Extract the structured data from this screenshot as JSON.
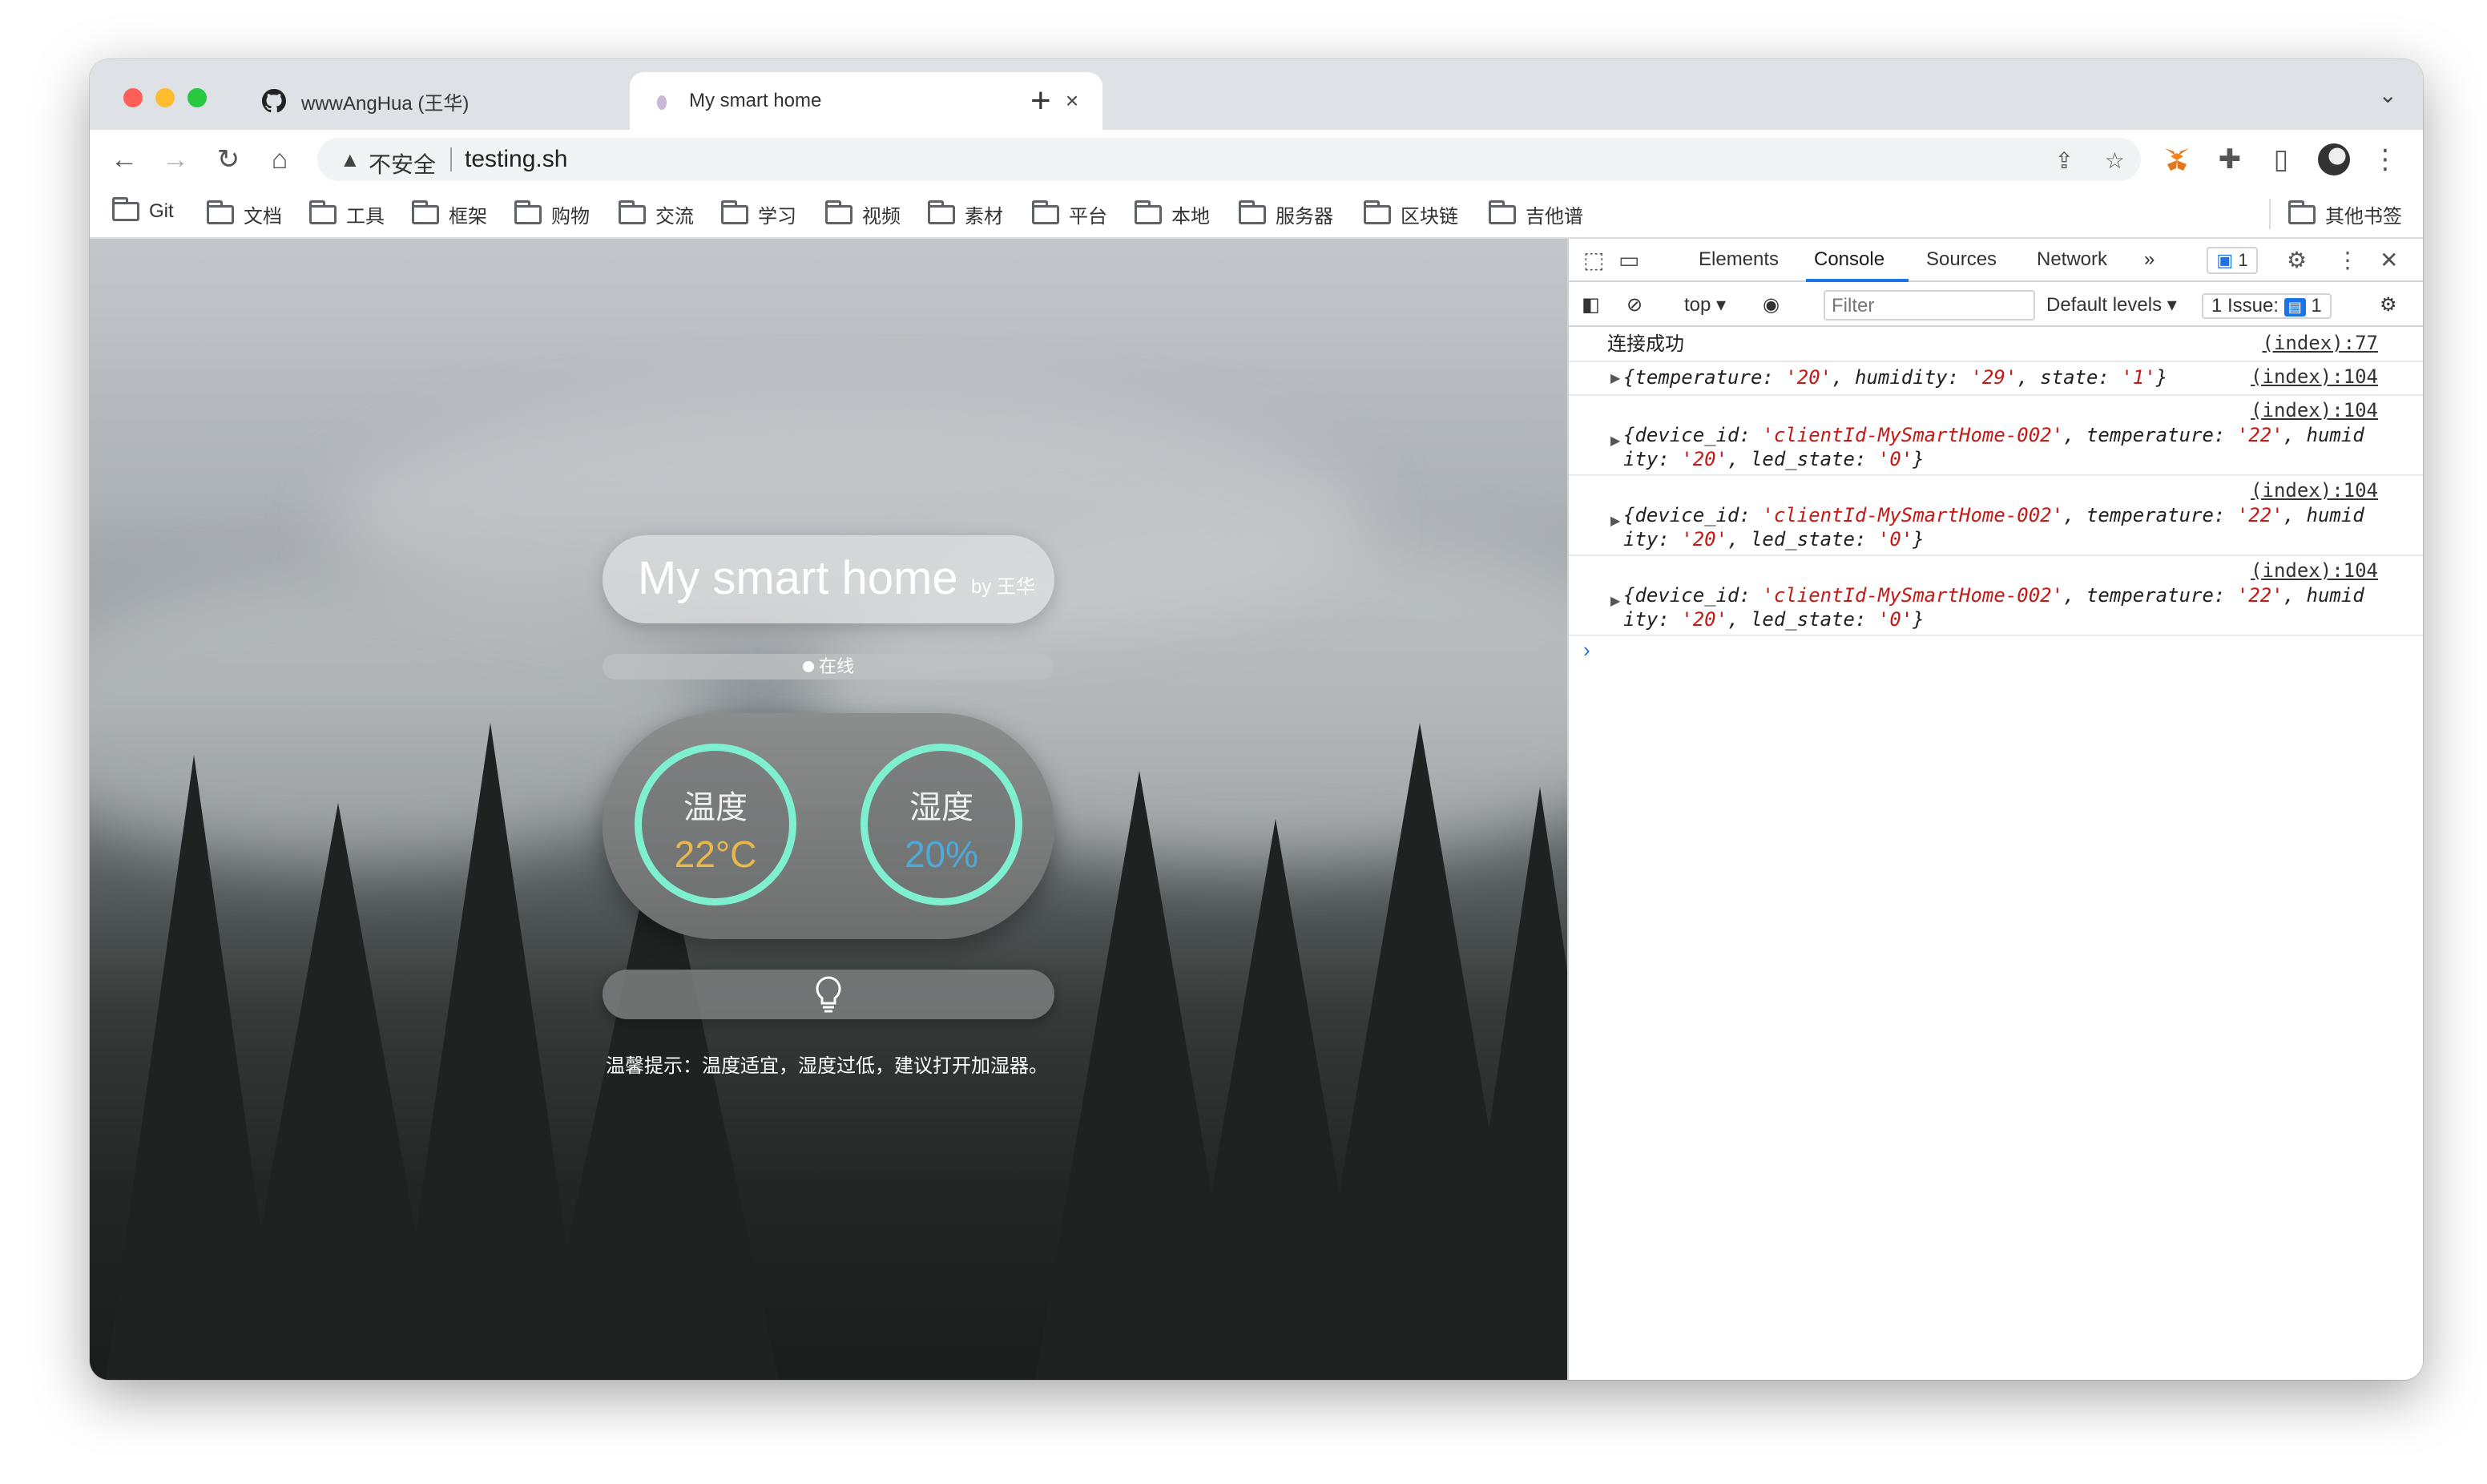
{
  "tabs": [
    {
      "title": "wwwAngHua (王华)",
      "icon": "github-icon",
      "close": "×"
    },
    {
      "title": "My smart home",
      "icon": "favicon-icon",
      "close": "×"
    }
  ],
  "new_tab_label": "+",
  "address_bar": {
    "warning_icon": "warning-icon",
    "security_text": "不安全",
    "url": "testing.sh"
  },
  "bookmarks": [
    "Git",
    "文档",
    "工具",
    "框架",
    "购物",
    "交流",
    "学习",
    "视频",
    "素材",
    "平台",
    "本地",
    "服务器",
    "区块链",
    "吉他谱"
  ],
  "other_bookmarks": "其他书签",
  "page": {
    "title": "My smart home",
    "byline": "by 王华",
    "status": "在线",
    "temperature": {
      "label": "温度",
      "value": "22°C",
      "color": "#e8b94a"
    },
    "humidity": {
      "label": "湿度",
      "value": "20%",
      "color": "#4fa9d6"
    },
    "gauge_ring_color": "#7ff0cf",
    "light_icon": "bulb-icon",
    "tip": "温馨提示：温度适宜，湿度过低，建议打开加湿器。"
  },
  "devtools": {
    "tabs": [
      "Elements",
      "Console",
      "Sources",
      "Network"
    ],
    "more": "»",
    "issues_badge": "1",
    "context": "top",
    "filter_placeholder": "Filter",
    "levels": "Default levels",
    "issue_label": "1 Issue:",
    "issue_count": "1",
    "logs": [
      {
        "text": "连接成功",
        "source": "(index):77"
      },
      {
        "source": "(index):104"
      },
      {
        "source": "(index):104"
      },
      {
        "source": "(index):104"
      },
      {
        "source": "(index):104"
      }
    ],
    "prompt": "›"
  }
}
